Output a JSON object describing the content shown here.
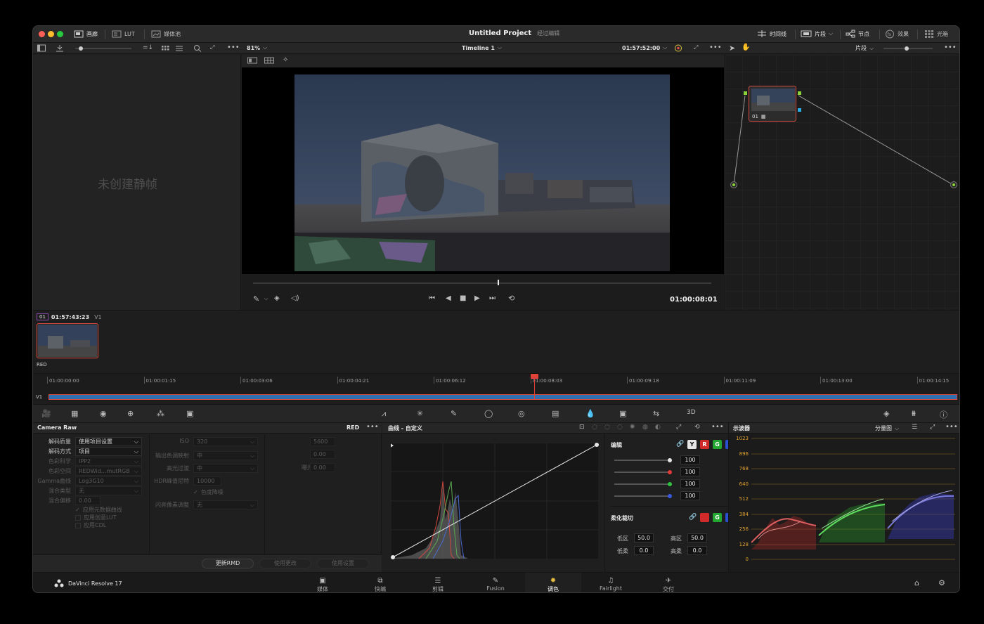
{
  "titlebar": {
    "project_title": "Untitled Project",
    "project_status": "经过编辑",
    "left_tabs": [
      {
        "label": "画廊",
        "icon": "gallery-icon"
      },
      {
        "label": "LUT",
        "icon": "lut-icon"
      },
      {
        "label": "媒体池",
        "icon": "media-pool-icon"
      }
    ],
    "right_tabs": [
      {
        "label": "时间线",
        "icon": "timeline-icon"
      },
      {
        "label": "片段",
        "icon": "clips-icon"
      },
      {
        "label": "节点",
        "icon": "nodes-icon"
      },
      {
        "label": "效果",
        "icon": "fx-icon"
      },
      {
        "label": "光箱",
        "icon": "lightbox-icon"
      }
    ]
  },
  "viewer": {
    "zoom": "81%",
    "timeline_name": "Timeline 1",
    "timecode_top": "01:57:52:00",
    "timecode_current": "01:00:08:01"
  },
  "gallery": {
    "empty_text": "未创建静帧"
  },
  "node_editor": {
    "mode": "片段",
    "node_label": "01"
  },
  "clip_strip": {
    "clip_number": "01",
    "clip_timecode": "01:57:43:23",
    "track": "V1",
    "clip_codec": "RED"
  },
  "mini_timeline": {
    "track": "V1",
    "ticks": [
      "01:00:00:00",
      "01:00:01:15",
      "01:00:03:06",
      "01:00:04:21",
      "01:00:06:12",
      "01:00:08:03",
      "01:00:09:18",
      "01:00:11:09",
      "01:00:13:00",
      "01:00:14:15"
    ]
  },
  "camera_raw": {
    "title": "Camera Raw",
    "codec": "RED",
    "decode_quality_label": "解码质量",
    "decode_quality_value": "使用项目设置",
    "decode_method_label": "解码方式",
    "decode_method_value": "项目",
    "color_science_label": "色彩科学",
    "color_science_value": "IPP2",
    "color_space_label": "色彩空间",
    "color_space_value": "REDWid...mutRGB",
    "gamma_label": "Gamma曲线",
    "gamma_value": "Log3G10",
    "mix_type_label": "混合类型",
    "mix_type_value": "无",
    "mix_offset_label": "混合偏移",
    "mix_offset_value": "0.00",
    "cb_metadata_curve": "应用元数据曲线",
    "cb_creative_lut": "应用创意LUT",
    "cb_cdl": "应用CDL",
    "iso_label": "ISO",
    "iso_value": "320",
    "output_tone_label": "输出色调映射",
    "output_tone_value": "中",
    "highlight_label": "高光过渡",
    "highlight_value": "中",
    "hdr_peak_label": "HDR峰值尼特",
    "hdr_peak_value": "10000",
    "gamut_compress": "色度降噪",
    "flash_pixel_label": "闪亮像素调整",
    "flash_pixel_value": "无",
    "color_temp_label": "色温",
    "color_temp_value": "5600",
    "tint_label": "色调",
    "tint_value": "0.00",
    "exposure_label": "曝光调整",
    "exposure_value": "0.00",
    "btn_update_rmd": "更新RMD",
    "btn_use_changes": "使用更改",
    "btn_use_settings": "使用设置"
  },
  "curves": {
    "title": "曲线 - 自定义",
    "edit_label": "编辑",
    "channels": [
      "Y",
      "R",
      "G",
      "B"
    ],
    "intensity_values": [
      "100",
      "100",
      "100",
      "100"
    ],
    "soft_clip_label": "柔化裁切",
    "low_label": "低区",
    "low_value": "50.0",
    "high_label": "高区",
    "high_value": "50.0",
    "low_soft_label": "低柔",
    "low_soft_value": "0.0",
    "high_soft_label": "高柔",
    "high_soft_value": "0.0"
  },
  "scope": {
    "title": "示波器",
    "mode": "分量图",
    "scale": [
      "1023",
      "896",
      "768",
      "640",
      "512",
      "384",
      "256",
      "128",
      "0"
    ]
  },
  "bottom_bar": {
    "app_name": "DaVinci Resolve 17",
    "pages": [
      {
        "label": "媒体",
        "icon": "media-page-icon"
      },
      {
        "label": "快编",
        "icon": "cut-page-icon"
      },
      {
        "label": "剪辑",
        "icon": "edit-page-icon"
      },
      {
        "label": "Fusion",
        "icon": "fusion-page-icon"
      },
      {
        "label": "调色",
        "icon": "color-page-icon"
      },
      {
        "label": "Fairlight",
        "icon": "fairlight-page-icon"
      },
      {
        "label": "交付",
        "icon": "deliver-page-icon"
      }
    ],
    "active_page": "调色"
  },
  "colors": {
    "accent_red": "#e0423a",
    "active_page": "#e14a3c",
    "scope_grid": "#8a6a2a"
  }
}
